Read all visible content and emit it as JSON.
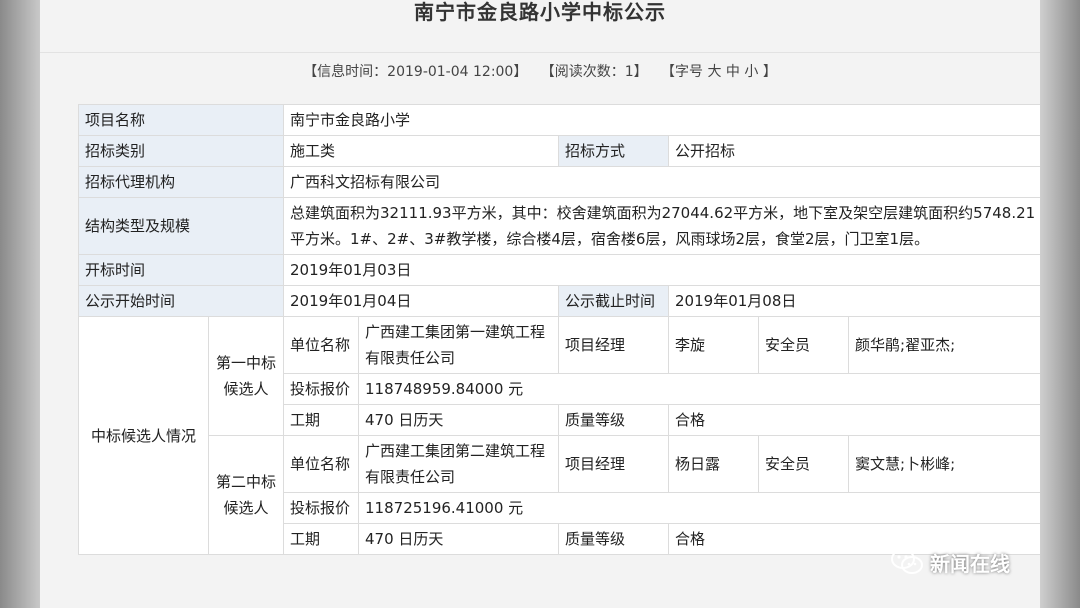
{
  "title": "南宁市金良路小学中标公示",
  "meta": {
    "info_time": "【信息时间：2019-01-04 12:00】",
    "read_count": "【阅读次数：1】",
    "font_size_prefix": "【字号",
    "size_large": "大",
    "size_medium": "中",
    "size_small": "小",
    "font_size_suffix": "】"
  },
  "table": {
    "project_name_label": "项目名称",
    "project_name": "南宁市金良路小学",
    "bid_category_label": "招标类别",
    "bid_category": "施工类",
    "bid_method_label": "招标方式",
    "bid_method": "公开招标",
    "agency_label": "招标代理机构",
    "agency": "广西科文招标有限公司",
    "structure_label": "结构类型及规模",
    "structure_text": "总建筑面积为32111.93平方米，其中：校舍建筑面积为27044.62平方米，地下室及架空层建筑面积约5748.21平方米。1#、2#、3#教学楼，综合楼4层，宿舍楼6层，风雨球场2层，食堂2层，门卫室1层。",
    "open_time_label": "开标时间",
    "open_time": "2019年01月03日",
    "publicity_start_label": "公示开始时间",
    "publicity_start": "2019年01月04日",
    "publicity_end_label": "公示截止时间",
    "publicity_end": "2019年01月08日",
    "candidates_group_label": "中标候选人情况",
    "candidates": [
      {
        "rank_label": "第一中标候选人",
        "unit_label": "单位名称",
        "unit": "广西建工集团第一建筑工程有限责任公司",
        "manager_label": "项目经理",
        "manager": "李旋",
        "safety_label": "安全员",
        "safety": "颜华鹃;翟亚杰;",
        "price_label": "投标报价",
        "price": "118748959.84000 元",
        "period_label": "工期",
        "period": "470 日历天",
        "quality_label": "质量等级",
        "quality": "合格"
      },
      {
        "rank_label": "第二中标候选人",
        "unit_label": "单位名称",
        "unit": "广西建工集团第二建筑工程有限责任公司",
        "manager_label": "项目经理",
        "manager": "杨日露",
        "safety_label": "安全员",
        "safety": "窦文慧;卜彬峰;",
        "price_label": "投标报价",
        "price": "118725196.41000 元",
        "period_label": "工期",
        "period": "470 日历天",
        "quality_label": "质量等级",
        "quality": "合格"
      }
    ]
  },
  "watermark": {
    "label": "新闻在线",
    "icon": "wechat-icon"
  }
}
